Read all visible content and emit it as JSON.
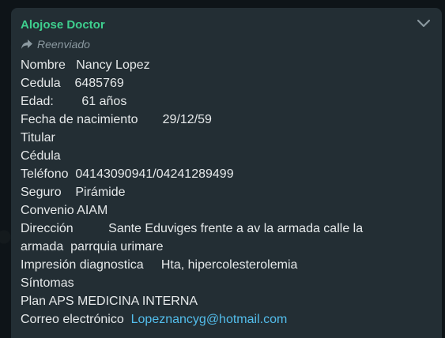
{
  "message": {
    "sender": "Alojose Doctor",
    "forwarded_label": "Reenviado",
    "lines": [
      "Nombre   Nancy Lopez",
      "Cedula    6485769",
      "Edad:        61 años",
      "Fecha de nacimiento       29/12/59",
      "Titular",
      "Cédula",
      "Teléfono  04143090941/04241289499",
      "Seguro    Pirámide",
      "Convenio AIAM",
      "Dirección          Sante Eduviges frente a av la armada calle la",
      "armada  parrquia urimare",
      "Impresión diagnostica     Hta, hipercolesterolemia",
      "Síntomas",
      "Plan APS MEDICINA INTERNA"
    ],
    "email_label": "Correo electrónico  ",
    "email_link": "Lopeznancyg@hotmail.com"
  },
  "colors": {
    "background": "#0e1418",
    "bubble": "#232e34",
    "sender": "#3ecf8e",
    "text": "#e6e9ea",
    "link": "#53bdeb",
    "muted": "#8a989f"
  },
  "icons": {
    "forward": "forward-arrow-icon",
    "menu": "chevron-down-icon"
  }
}
